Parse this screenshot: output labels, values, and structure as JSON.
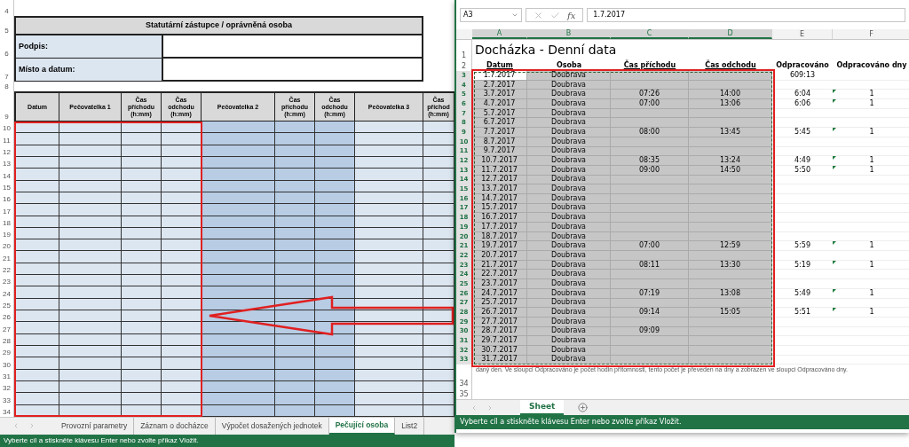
{
  "left_sheet": {
    "top_rows": [
      "4",
      "5",
      "6",
      "7",
      "8",
      "9"
    ],
    "signature_block": {
      "title": "Statutární zástupce / oprávněná osoba",
      "fields": [
        {
          "label": "Podpis:"
        },
        {
          "label": "Místo a datum:"
        }
      ]
    },
    "columns": [
      {
        "header": "Datum",
        "shaded": false
      },
      {
        "header": "Pečovatelka 1",
        "shaded": false
      },
      {
        "header": "Čas příchodu (h:mm)",
        "shaded": false
      },
      {
        "header": "Čas odchodu (h:mm)",
        "shaded": false
      },
      {
        "header": "Pečovatelka 2",
        "shaded": true
      },
      {
        "header": "Čas příchodu (h:mm)",
        "shaded": true
      },
      {
        "header": "Čas odchodu (h:mm)",
        "shaded": true
      },
      {
        "header": "Pečovatelka 3",
        "shaded": false
      },
      {
        "header": "Čas příchod (h:mm)",
        "shaded": false
      }
    ],
    "row_numbers": [
      "10",
      "11",
      "12",
      "13",
      "14",
      "15",
      "16",
      "17",
      "18",
      "19",
      "20",
      "21",
      "22",
      "23",
      "24",
      "25",
      "26",
      "27",
      "28",
      "29",
      "30",
      "31",
      "32",
      "33",
      "34"
    ],
    "sheet_tabs": [
      {
        "label": "Provozní parametry",
        "selected": false
      },
      {
        "label": "Záznam o docházce",
        "selected": false
      },
      {
        "label": "Výpočet dosažených jednotek",
        "selected": false
      },
      {
        "label": "Pečující osoba",
        "selected": true
      },
      {
        "label": "List2",
        "selected": false
      }
    ],
    "status_bar": "Vyberte cíl a stiskněte klávesu Enter nebo zvolte příkaz Vložit."
  },
  "right_window": {
    "name_box": "A3",
    "fx_label": "fx",
    "formula": "1.7.2017",
    "columns": [
      {
        "label": "A",
        "selected": true
      },
      {
        "label": "B",
        "selected": true
      },
      {
        "label": "C",
        "selected": true
      },
      {
        "label": "D",
        "selected": true
      },
      {
        "label": "E",
        "selected": false
      },
      {
        "label": "F",
        "selected": false
      }
    ],
    "title_row": "1",
    "title": "Docházka - Denní data",
    "header_row": "2",
    "headers": [
      {
        "label": "Datum",
        "underlined": true
      },
      {
        "label": "Osoba",
        "underlined": false
      },
      {
        "label": "Čas příchodu",
        "underlined": true
      },
      {
        "label": "Čas odchodu",
        "underlined": true
      },
      {
        "label": "Odpracováno",
        "underlined": false
      },
      {
        "label": "Odpracováno dny",
        "underlined": false
      }
    ],
    "rows": [
      {
        "n": "3",
        "date": "1.7.2017",
        "person": "Doubrava",
        "worked": "609:13",
        "active": true,
        "flag": false
      },
      {
        "n": "4",
        "date": "2.7.2017",
        "person": "Doubrava",
        "active": false,
        "flag": false
      },
      {
        "n": "5",
        "date": "3.7.2017",
        "person": "Doubrava",
        "arrive": "07:26",
        "leave": "14:00",
        "worked": "6:04",
        "days": "1",
        "active": false,
        "flag": true
      },
      {
        "n": "6",
        "date": "4.7.2017",
        "person": "Doubrava",
        "arrive": "07:00",
        "leave": "13:06",
        "worked": "6:06",
        "days": "1",
        "active": false,
        "flag": true
      },
      {
        "n": "7",
        "date": "5.7.2017",
        "person": "Doubrava",
        "active": false,
        "flag": false
      },
      {
        "n": "8",
        "date": "6.7.2017",
        "person": "Doubrava",
        "active": false,
        "flag": false
      },
      {
        "n": "9",
        "date": "7.7.2017",
        "person": "Doubrava",
        "arrive": "08:00",
        "leave": "13:45",
        "worked": "5:45",
        "days": "1",
        "active": false,
        "flag": true
      },
      {
        "n": "10",
        "date": "8.7.2017",
        "person": "Doubrava",
        "active": false,
        "flag": false
      },
      {
        "n": "11",
        "date": "9.7.2017",
        "person": "Doubrava",
        "active": false,
        "flag": false
      },
      {
        "n": "12",
        "date": "10.7.2017",
        "person": "Doubrava",
        "arrive": "08:35",
        "leave": "13:24",
        "worked": "4:49",
        "days": "1",
        "active": false,
        "flag": true
      },
      {
        "n": "13",
        "date": "11.7.2017",
        "person": "Doubrava",
        "arrive": "09:00",
        "leave": "14:50",
        "worked": "5:50",
        "days": "1",
        "active": false,
        "flag": true
      },
      {
        "n": "14",
        "date": "12.7.2017",
        "person": "Doubrava",
        "active": false,
        "flag": false
      },
      {
        "n": "15",
        "date": "13.7.2017",
        "person": "Doubrava",
        "active": false,
        "flag": false
      },
      {
        "n": "16",
        "date": "14.7.2017",
        "person": "Doubrava",
        "active": false,
        "flag": false
      },
      {
        "n": "17",
        "date": "15.7.2017",
        "person": "Doubrava",
        "active": false,
        "flag": false
      },
      {
        "n": "18",
        "date": "16.7.2017",
        "person": "Doubrava",
        "active": false,
        "flag": false
      },
      {
        "n": "19",
        "date": "17.7.2017",
        "person": "Doubrava",
        "active": false,
        "flag": false
      },
      {
        "n": "20",
        "date": "18.7.2017",
        "person": "Doubrava",
        "active": false,
        "flag": false
      },
      {
        "n": "21",
        "date": "19.7.2017",
        "person": "Doubrava",
        "arrive": "07:00",
        "leave": "12:59",
        "worked": "5:59",
        "days": "1",
        "active": false,
        "flag": true
      },
      {
        "n": "22",
        "date": "20.7.2017",
        "person": "Doubrava",
        "active": false,
        "flag": false
      },
      {
        "n": "23",
        "date": "21.7.2017",
        "person": "Doubrava",
        "arrive": "08:11",
        "leave": "13:30",
        "worked": "5:19",
        "days": "1",
        "active": false,
        "flag": true
      },
      {
        "n": "24",
        "date": "22.7.2017",
        "person": "Doubrava",
        "active": false,
        "flag": false
      },
      {
        "n": "25",
        "date": "23.7.2017",
        "person": "Doubrava",
        "active": false,
        "flag": false
      },
      {
        "n": "26",
        "date": "24.7.2017",
        "person": "Doubrava",
        "arrive": "07:19",
        "leave": "13:08",
        "worked": "5:49",
        "days": "1",
        "active": false,
        "flag": true
      },
      {
        "n": "27",
        "date": "25.7.2017",
        "person": "Doubrava",
        "active": false,
        "flag": false
      },
      {
        "n": "28",
        "date": "26.7.2017",
        "person": "Doubrava",
        "arrive": "09:14",
        "leave": "15:05",
        "worked": "5:51",
        "days": "1",
        "active": false,
        "flag": true
      },
      {
        "n": "29",
        "date": "27.7.2017",
        "person": "Doubrava",
        "active": false,
        "flag": false
      },
      {
        "n": "30",
        "date": "28.7.2017",
        "person": "Doubrava",
        "arrive": "09:09",
        "active": false,
        "flag": false
      },
      {
        "n": "31",
        "date": "29.7.2017",
        "person": "Doubrava",
        "active": false,
        "flag": false
      },
      {
        "n": "32",
        "date": "30.7.2017",
        "person": "Doubrava",
        "active": false,
        "flag": false
      },
      {
        "n": "33",
        "date": "31.7.2017",
        "person": "Doubrava",
        "active": false,
        "flag": false
      }
    ],
    "note_row": "34",
    "note": "daný den. Ve sloupci Odpracováno je počet hodin přítomnosti, tento počet je převeden na dny a zobrazen ve sloupci Odpracováno dny.",
    "last_row": "35",
    "sheet_tabs": [
      {
        "label": "Sheet",
        "selected": true
      }
    ],
    "status_bar": "Vyberte cíl a stiskněte klávesu Enter nebo zvolte příkaz Vložit."
  }
}
